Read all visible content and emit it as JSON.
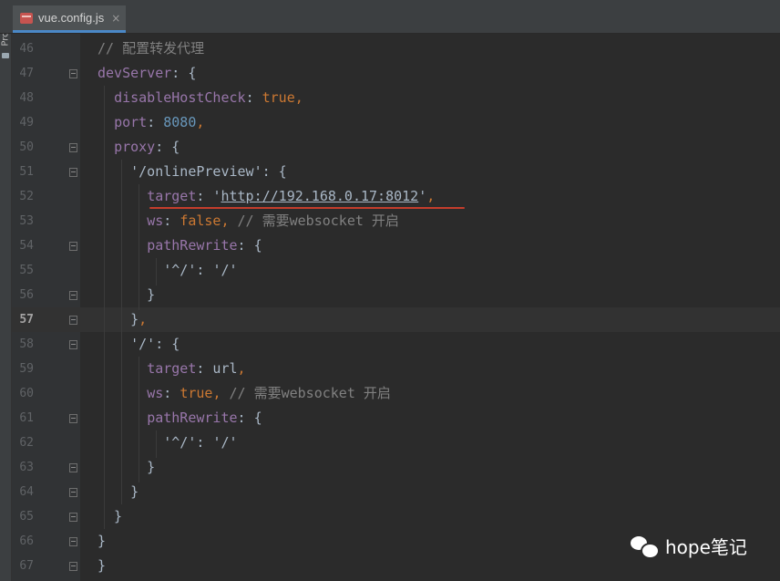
{
  "sidebar": {
    "project_label": "Project"
  },
  "tab": {
    "label": "vue.config.js",
    "close": "×"
  },
  "editor": {
    "current_line": 57,
    "lines": [
      {
        "num": "46",
        "tokens": [
          {
            "t": "// 配置转发代理",
            "c": "comment"
          }
        ]
      },
      {
        "num": "47",
        "tokens": [
          {
            "t": "devServer",
            "c": "key"
          },
          {
            "t": ": {",
            "c": "punct"
          }
        ]
      },
      {
        "num": "48",
        "tokens": [
          {
            "t": "  ",
            "c": "punct"
          },
          {
            "t": "disableHostCheck",
            "c": "key"
          },
          {
            "t": ": ",
            "c": "punct"
          },
          {
            "t": "true",
            "c": "bool"
          },
          {
            "t": ",",
            "c": "comma"
          }
        ]
      },
      {
        "num": "49",
        "tokens": [
          {
            "t": "  ",
            "c": "punct"
          },
          {
            "t": "port",
            "c": "key"
          },
          {
            "t": ": ",
            "c": "punct"
          },
          {
            "t": "8080",
            "c": "num"
          },
          {
            "t": ",",
            "c": "comma"
          }
        ]
      },
      {
        "num": "50",
        "tokens": [
          {
            "t": "  ",
            "c": "punct"
          },
          {
            "t": "proxy",
            "c": "key"
          },
          {
            "t": ": {",
            "c": "punct"
          }
        ]
      },
      {
        "num": "51",
        "tokens": [
          {
            "t": "    ",
            "c": "punct"
          },
          {
            "t": "'/onlinePreview'",
            "c": "strplain"
          },
          {
            "t": ": {",
            "c": "punct"
          }
        ]
      },
      {
        "num": "52",
        "tokens": [
          {
            "t": "      ",
            "c": "punct"
          },
          {
            "t": "target",
            "c": "key"
          },
          {
            "t": ": ",
            "c": "punct"
          },
          {
            "t": "'",
            "c": "strplain"
          },
          {
            "t": "http://192.168.0.17:8012",
            "c": "url"
          },
          {
            "t": "'",
            "c": "strplain"
          },
          {
            "t": ",",
            "c": "comma"
          }
        ]
      },
      {
        "num": "53",
        "tokens": [
          {
            "t": "      ",
            "c": "punct"
          },
          {
            "t": "ws",
            "c": "key"
          },
          {
            "t": ": ",
            "c": "punct"
          },
          {
            "t": "false",
            "c": "bool"
          },
          {
            "t": ", ",
            "c": "comma"
          },
          {
            "t": "// 需要websocket 开启",
            "c": "comment"
          }
        ]
      },
      {
        "num": "54",
        "tokens": [
          {
            "t": "      ",
            "c": "punct"
          },
          {
            "t": "pathRewrite",
            "c": "key"
          },
          {
            "t": ": {",
            "c": "punct"
          }
        ]
      },
      {
        "num": "55",
        "tokens": [
          {
            "t": "        ",
            "c": "punct"
          },
          {
            "t": "'^/'",
            "c": "strplain"
          },
          {
            "t": ": ",
            "c": "punct"
          },
          {
            "t": "'/'",
            "c": "strplain"
          }
        ]
      },
      {
        "num": "56",
        "tokens": [
          {
            "t": "      }",
            "c": "punct"
          }
        ]
      },
      {
        "num": "57",
        "tokens": [
          {
            "t": "    }",
            "c": "punct"
          },
          {
            "t": ",",
            "c": "comma"
          }
        ]
      },
      {
        "num": "58",
        "tokens": [
          {
            "t": "    ",
            "c": "punct"
          },
          {
            "t": "'/'",
            "c": "strplain"
          },
          {
            "t": ": {",
            "c": "punct"
          }
        ]
      },
      {
        "num": "59",
        "tokens": [
          {
            "t": "      ",
            "c": "punct"
          },
          {
            "t": "target",
            "c": "key"
          },
          {
            "t": ": url",
            "c": "punct"
          },
          {
            "t": ",",
            "c": "comma"
          }
        ]
      },
      {
        "num": "60",
        "tokens": [
          {
            "t": "      ",
            "c": "punct"
          },
          {
            "t": "ws",
            "c": "key"
          },
          {
            "t": ": ",
            "c": "punct"
          },
          {
            "t": "true",
            "c": "bool"
          },
          {
            "t": ", ",
            "c": "comma"
          },
          {
            "t": "// 需要websocket 开启",
            "c": "comment"
          }
        ]
      },
      {
        "num": "61",
        "tokens": [
          {
            "t": "      ",
            "c": "punct"
          },
          {
            "t": "pathRewrite",
            "c": "key"
          },
          {
            "t": ": {",
            "c": "punct"
          }
        ]
      },
      {
        "num": "62",
        "tokens": [
          {
            "t": "        ",
            "c": "punct"
          },
          {
            "t": "'^/'",
            "c": "strplain"
          },
          {
            "t": ": ",
            "c": "punct"
          },
          {
            "t": "'/'",
            "c": "strplain"
          }
        ]
      },
      {
        "num": "63",
        "tokens": [
          {
            "t": "      }",
            "c": "punct"
          }
        ]
      },
      {
        "num": "64",
        "tokens": [
          {
            "t": "    }",
            "c": "punct"
          }
        ]
      },
      {
        "num": "65",
        "tokens": [
          {
            "t": "  }",
            "c": "punct"
          }
        ]
      },
      {
        "num": "66",
        "tokens": [
          {
            "t": "}",
            "c": "punct"
          }
        ]
      },
      {
        "num": "67",
        "tokens": [
          {
            "t": "}",
            "c": "punct"
          }
        ]
      }
    ]
  },
  "watermark": {
    "text": "hope笔记",
    "icon": "wechat-icon"
  }
}
